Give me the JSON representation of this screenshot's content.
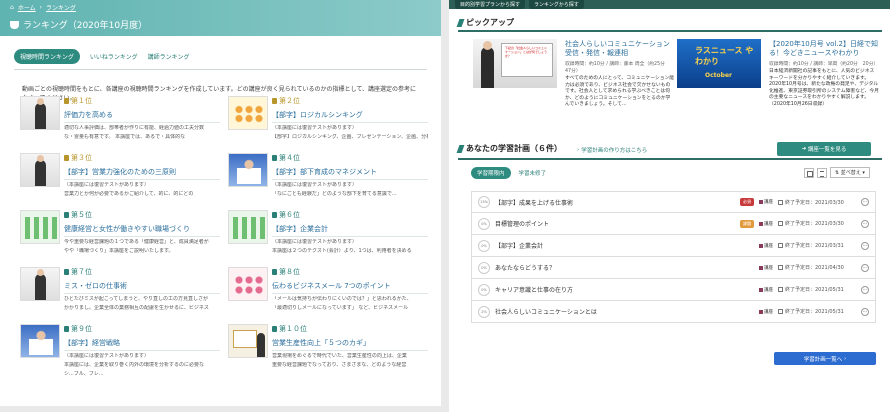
{
  "left": {
    "breadcrumb": [
      "ホーム",
      "ランキング"
    ],
    "title": "ランキング（2020年10月度）",
    "tabs": [
      "視聴時間ランキング",
      "いいねランキング",
      "講師ランキング"
    ],
    "description": "動画ごとの視聴時間をもとに、各講座の視聴時間ランキングを作成しています。どの講座が良く見られているのかの指標として、講座選定の参考になさってください。",
    "items": [
      {
        "rank": "第１位",
        "title": "評価力を高める",
        "text": [
          "適切な人事評価は、部帯者が作りに有能、経過力値の工夫分数",
          "な・霊量も有意です。 本講座では、あるで・具体的な"
        ]
      },
      {
        "rank": "第２位",
        "title": "【部字】ロジカルシンキング",
        "text": [
          "（本講座には復習テストがあります）",
          "【部字】ロジカルシンキング、企画、ブレゼンテーション、企画、分析、報告"
        ]
      },
      {
        "rank": "第３位",
        "title": "【部字】営業力強化のための三原則",
        "text": [
          "（本講座には復習テストがあります）",
          "営業力とか何が必要であるかご紹介して、的に、的にどの"
        ]
      },
      {
        "rank": "第４位",
        "title": "【部字】部下育成のマネジメント",
        "text": [
          "（本講座には復習テストがあります）",
          "「なにごとも経験だ」どのような部下を育てる意識で..."
        ]
      },
      {
        "rank": "第５位",
        "title": "健康経営と女性が働きやすい職場づくり",
        "text": [
          "今や重要な経営課題の１つである「健康経営」と、成員満足者が",
          "やや「職場づくり」本講座をご説明いたします。"
        ]
      },
      {
        "rank": "第６位",
        "title": "【部字】企業会計",
        "text": [
          "（本講座には復習テストがあります）",
          "本講座は２つのテクスト(会計）より、1つは、利用者を決める"
        ]
      },
      {
        "rank": "第７位",
        "title": "ミス・ゼロの仕事術",
        "text": [
          "ひとたびミスが起こってしまうと、やり直しの工の方見直しさが",
          "かかりまし。企業全体の業務相互の配慮を生かせるに、ビジネス"
        ]
      },
      {
        "rank": "第８位",
        "title": "伝わるビジネスメール 7つのポイント",
        "text": [
          "「メールは気持ちが伝わりにくいのでは？」と思われるかた、",
          "「最適切りしメールになっています」 など、ビジネスメール"
        ]
      },
      {
        "rank": "第９位",
        "title": "【部字】経営戦略",
        "text": [
          "（本講座には復習テストがあります）",
          "本講座には、企業を取り巻く内外の環境を分析するのに必要な",
          "シ...ブル、ブレ..."
        ]
      },
      {
        "rank": "第１０位",
        "title": "営業生産性向上「５つのカギ」",
        "text": [
          "営業現場をめぐるで時代でいた、営業生産性の向上は、企業",
          "重要な経営課題でなっており、さまざまな、どのような経営"
        ]
      }
    ]
  },
  "right": {
    "top_tabs": [
      "目的別学習プランから探す",
      "ランキングから探す"
    ],
    "pickup": {
      "heading": "ピックアップ",
      "items": [
        {
          "slide_text": "下記の「社会人らしいコミュニケーション」とはが何でしょうか？",
          "title": "社会人らしいコミュニケーション 受信・発信・報連相",
          "meta": "収録時間：約10分 / 講師：藤本 周全（約25分　47分）",
          "body": "すべてのための人にとって、コミュニケーション能力は必須であり、ビジネス社会で欠かせないものです。社会人として求められる学ぶべきことは何か、どのようにコミュニケーションをとるのか学んでいきましょう。そして..."
        },
        {
          "logo_text": "ラスニュース やわかり",
          "month": "October",
          "title": "【2020年10月号 vol.2】日経で知る！今どきニュースやわかり",
          "meta": "収録時間：約10分 / 講師：早岡（約20分　20分）",
          "body": "日本経済新聞社の記事をもとに、人気のビジネスキーワードを分かりやすく紹介していきます。2020年10月号は、新たな政権の発足や、デジタル化推進、東京証券取引所のシステム障害など、今月の主要なニュースをわかりやすく解説します。（2020年10月26日収録）"
        }
      ]
    },
    "plan": {
      "heading": "あなたの学習計画（６件）",
      "howto_link": "学習計画の作り方はこちら",
      "list_button": "講座一覧を見る",
      "tabs": [
        "学習期限内",
        "学習未修了"
      ],
      "sort_label": "並べ替え",
      "rows": [
        {
          "pct": "13%",
          "title": "【部字】成果を上げる仕事術",
          "tag": "必須",
          "tag_type": "must",
          "type": "講座",
          "date": "終了予定日：2021/03/30"
        },
        {
          "pct": "0%",
          "title": "目標管理のポイント",
          "tag": "課題",
          "tag_type": "kadai",
          "type": "講座",
          "date": "終了予定日：2021/03/30"
        },
        {
          "pct": "0%",
          "title": "【部字】企業会計",
          "tag": "",
          "tag_type": "",
          "type": "講座",
          "date": "終了予定日：2021/03/31"
        },
        {
          "pct": "0%",
          "title": "あなたならどうする？",
          "tag": "",
          "tag_type": "",
          "type": "講座",
          "date": "終了予定日：2021/04/30"
        },
        {
          "pct": "0%",
          "title": "キャリア意識と仕事の在り方",
          "tag": "",
          "tag_type": "",
          "type": "講座",
          "date": "終了予定日：2021/05/31"
        },
        {
          "pct": "2%",
          "title": "社会人らしいコミュニケーションとは",
          "tag": "",
          "tag_type": "",
          "type": "講座",
          "date": "終了予定日：2021/05/31"
        }
      ],
      "more_button": "学習計画一覧へ"
    }
  }
}
